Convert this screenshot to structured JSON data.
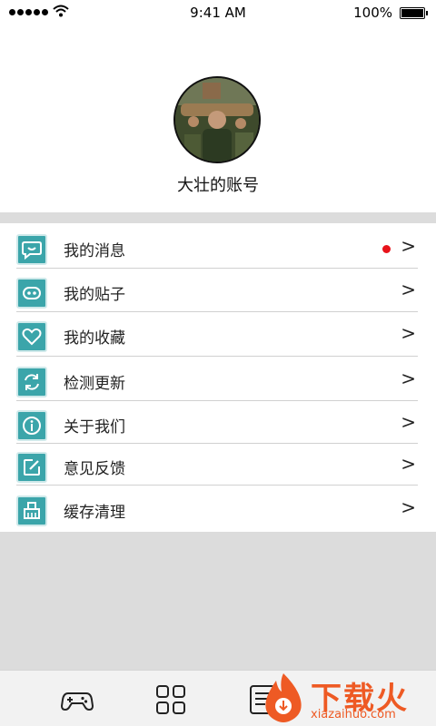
{
  "status_bar": {
    "time": "9:41 AM",
    "battery": "100%"
  },
  "profile": {
    "username": "大壮的账号",
    "avatar_icon": "avatar-photo"
  },
  "menu": {
    "items": [
      {
        "label": "我的消息",
        "icon": "message-bubble-icon",
        "has_dot": true,
        "chevron": ">"
      },
      {
        "label": "我的贴子",
        "icon": "posts-icon",
        "has_dot": false,
        "chevron": ">"
      },
      {
        "label": "我的收藏",
        "icon": "heart-icon",
        "has_dot": false,
        "chevron": ">"
      },
      {
        "label": "检测更新",
        "icon": "refresh-icon",
        "has_dot": false,
        "chevron": ">"
      },
      {
        "label": "关于我们",
        "icon": "info-icon",
        "has_dot": false,
        "chevron": ">"
      },
      {
        "label": "意见反馈",
        "icon": "edit-icon",
        "has_dot": false,
        "chevron": ">"
      },
      {
        "label": "缓存清理",
        "icon": "broom-icon",
        "has_dot": false,
        "chevron": ">"
      }
    ]
  },
  "tabbar": {
    "tabs": [
      {
        "icon": "gamepad-icon"
      },
      {
        "icon": "grid-icon"
      },
      {
        "icon": "document-icon"
      }
    ]
  },
  "watermark": {
    "text": "下载火",
    "url": "xiazaihuo.com"
  },
  "colors": {
    "accent": "#3ba5aa",
    "dot": "#e8131a",
    "separator_bg": "#dcdcdc",
    "watermark": "#ee5a24"
  }
}
